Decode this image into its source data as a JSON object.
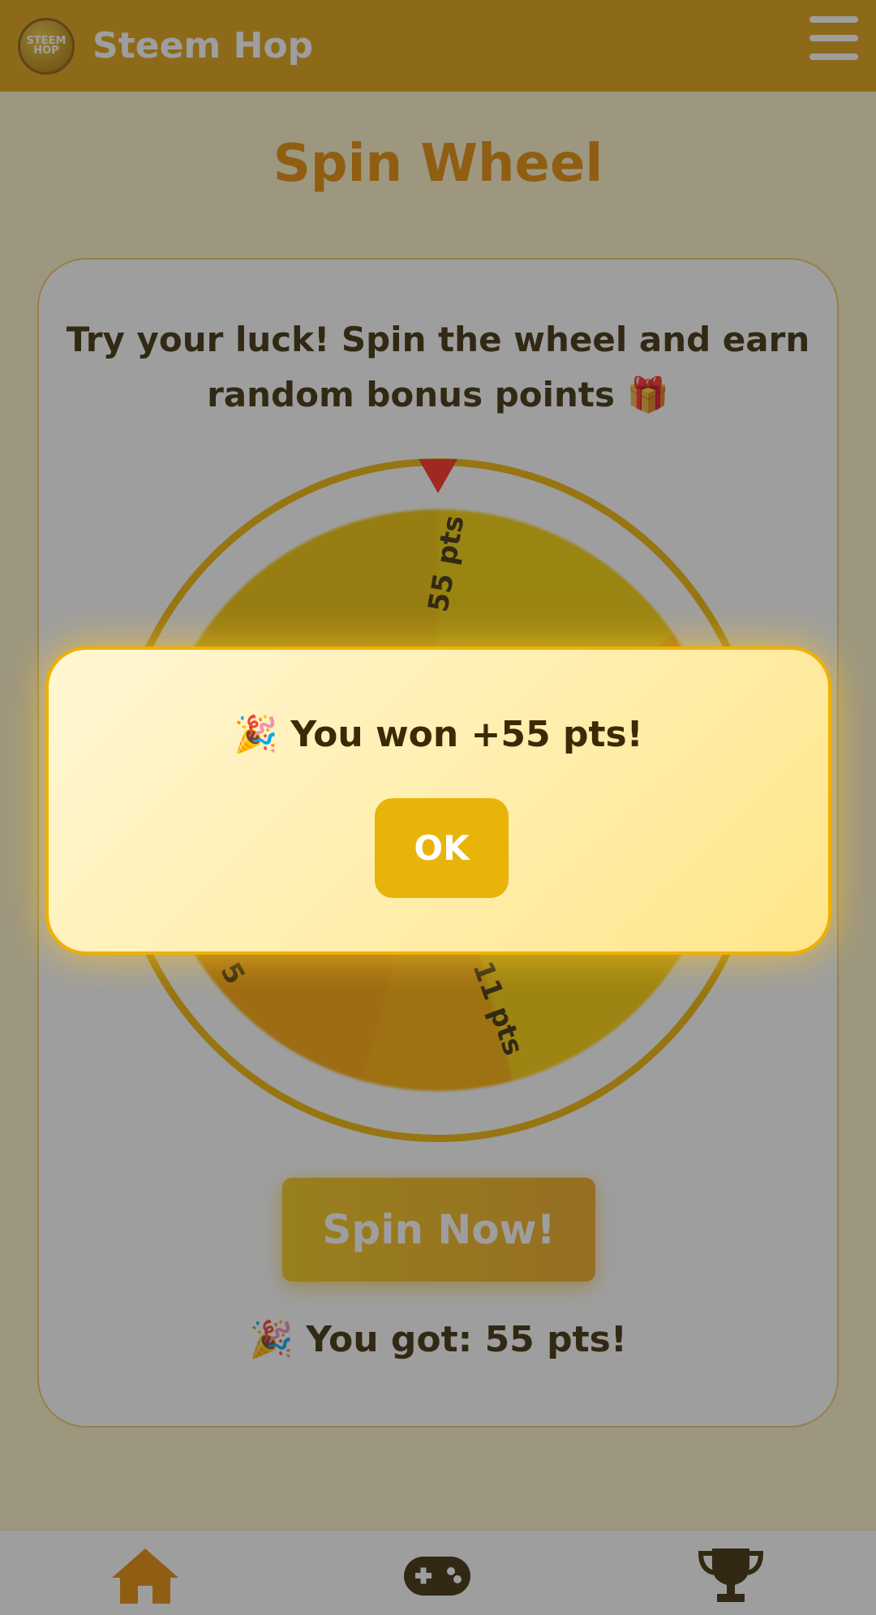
{
  "header": {
    "logo_text": "STEEM HOP",
    "title": "Steem Hop"
  },
  "page": {
    "title": "Spin Wheel",
    "intro": "Try your luck! Spin the wheel and earn random bonus points 🎁",
    "wheel_segments": [
      "55 pts",
      "11 pts",
      "5"
    ],
    "spin_button": "Spin Now!",
    "result": "🎉 You got: 55 pts!"
  },
  "dialog": {
    "message": "🎉 You won +55 pts!",
    "ok_label": "OK"
  },
  "nav": {
    "items": [
      "home-icon",
      "gamepad-icon",
      "trophy-icon"
    ],
    "active_color": "#e68a00",
    "inactive_color": "#3b2a05"
  },
  "colors": {
    "brand": "#e0a010",
    "accent": "#f0b400",
    "pointer": "#ff2a1a"
  }
}
